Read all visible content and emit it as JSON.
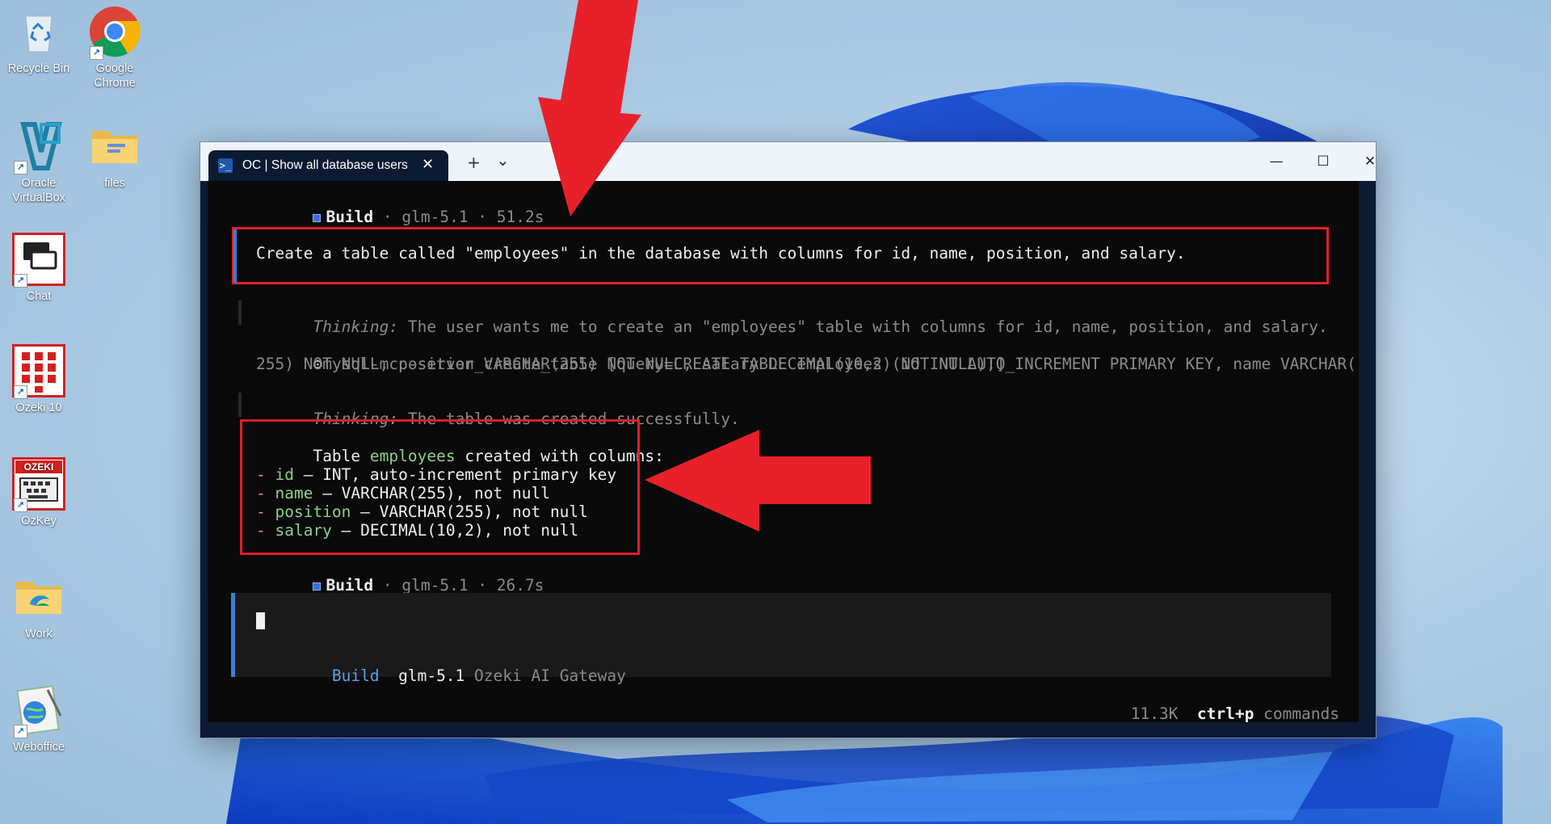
{
  "desktop": {
    "icons": [
      {
        "label": "Recycle Bin",
        "icon": "recycle-bin-icon"
      },
      {
        "label": "Google Chrome",
        "icon": "chrome-icon"
      },
      {
        "label": "Oracle VirtualBox",
        "icon": "virtualbox-icon"
      },
      {
        "label": "files",
        "icon": "folder-icon"
      },
      {
        "label": "Chat",
        "icon": "chat-icon"
      },
      {
        "label": "Ozeki 10",
        "icon": "ozeki-icon"
      },
      {
        "label": "OzKey",
        "icon": "ozkey-icon"
      },
      {
        "label": "Work",
        "icon": "folder-icon"
      },
      {
        "label": "Weboffice",
        "icon": "weboffice-icon"
      }
    ]
  },
  "window": {
    "tab_title": "OC | Show all database users",
    "new_tab": "+",
    "dropdown": "⌄",
    "minimize": "—",
    "maximize": "☐",
    "close": "✕"
  },
  "terminal": {
    "build1": {
      "label": "Build",
      "meta": "· glm-5.1 · 51.2s"
    },
    "user_prompt": "Create a table called \"employees\" in the database with columns for id, name, position, and salary.",
    "thinking1": {
      "label": "Thinking:",
      "text": " The user wants me to create an \"employees\" table with columns for id, name, position, and salary."
    },
    "tool_call": {
      "line1": "mysql-mcp-server_create_table [query=CREATE TABLE employees (id INT AUTO_INCREMENT PRIMARY KEY, name VARCHAR(",
      "line2": "255) NOT NULL, position VARCHAR(255) NOT NULL, salary DECIMAL(10,2) NOT NULL);]"
    },
    "thinking2": {
      "label": "Thinking:",
      "text": " The table was created successfully."
    },
    "result": {
      "intro_pre": "Table ",
      "intro_name": "employees",
      "intro_post": " created with columns:",
      "columns": [
        {
          "name": "id",
          "desc": " — INT, auto-increment primary key"
        },
        {
          "name": "name",
          "desc": " — VARCHAR(255), not null"
        },
        {
          "name": "position",
          "desc": " — VARCHAR(255), not null"
        },
        {
          "name": "salary",
          "desc": " — DECIMAL(10,2), not null"
        }
      ]
    },
    "build2": {
      "label": "Build",
      "meta": "· glm-5.1 · 26.7s"
    },
    "input": {
      "mode": "Build",
      "model": "glm-5.1",
      "provider": "Ozeki AI Gateway"
    },
    "status": {
      "tokens": "11.3K",
      "shortcut": "ctrl+p",
      "shortcut_label": "commands"
    }
  },
  "colors": {
    "accent_blue": "#3c7ed8",
    "annotation_red": "#e0202a",
    "terminal_bg": "#0a0a0a"
  }
}
